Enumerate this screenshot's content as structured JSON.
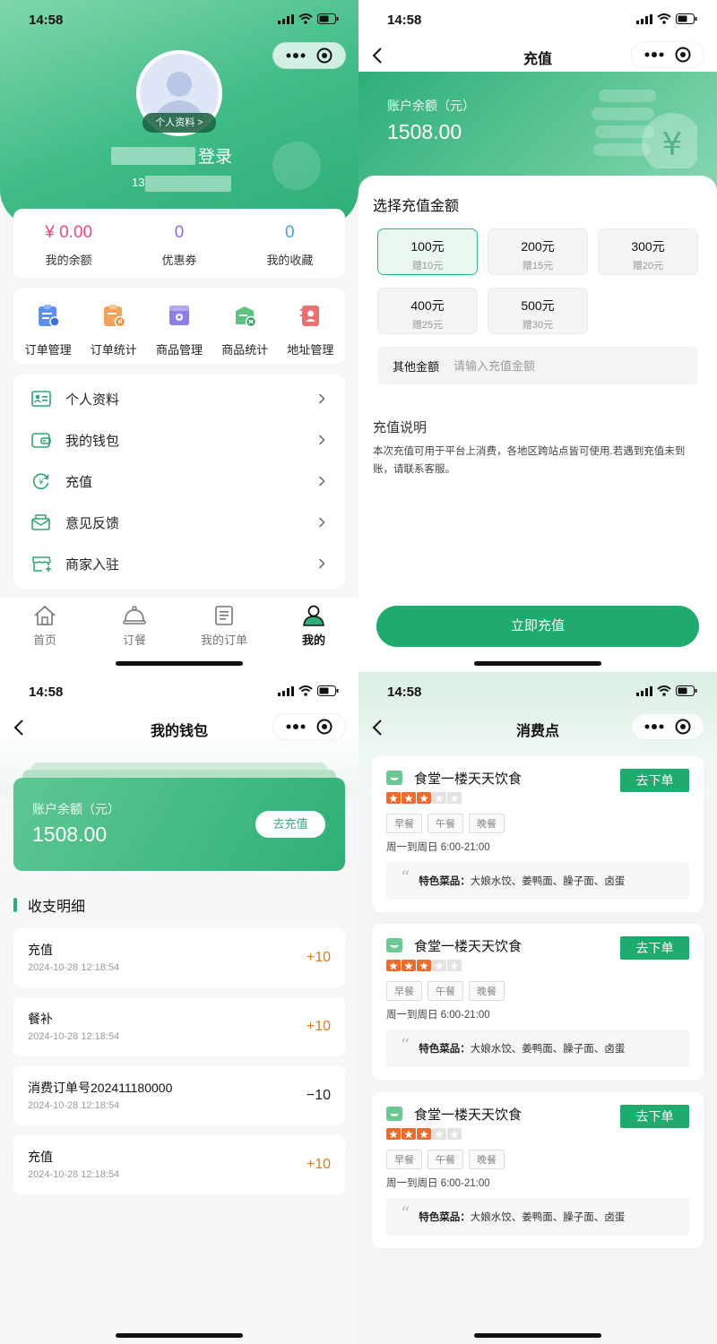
{
  "status_time": "14:58",
  "colors": {
    "primary": "#1faa6e",
    "header": "#3fbb86",
    "orange": "#e07c16",
    "balance_red": "#e6487a",
    "coupon_purple": "#8b6ce0",
    "fav_blue": "#4aa3e0"
  },
  "profile": {
    "avatar_tag": "个人资料 >",
    "login_label": "登录",
    "phone_prefix": "13",
    "stats": [
      {
        "value": "¥ 0.00",
        "label": "我的余额"
      },
      {
        "value": "0",
        "label": "优惠券"
      },
      {
        "value": "0",
        "label": "我的收藏"
      }
    ],
    "grid": [
      {
        "label": "订单管理",
        "icon": "order-manage-icon"
      },
      {
        "label": "订单统计",
        "icon": "order-stats-icon"
      },
      {
        "label": "商品管理",
        "icon": "product-manage-icon"
      },
      {
        "label": "商品统计",
        "icon": "product-stats-icon"
      },
      {
        "label": "地址管理",
        "icon": "address-manage-icon"
      }
    ],
    "menu": [
      {
        "label": "个人资料",
        "icon": "profile-card-icon"
      },
      {
        "label": "我的钱包",
        "icon": "wallet-icon"
      },
      {
        "label": "充值",
        "icon": "recharge-icon"
      },
      {
        "label": "意见反馈",
        "icon": "feedback-icon"
      },
      {
        "label": "商家入驻",
        "icon": "merchant-icon"
      }
    ],
    "tabs": [
      {
        "label": "首页",
        "icon": "home-icon"
      },
      {
        "label": "订餐",
        "icon": "dining-cloche-icon"
      },
      {
        "label": "我的订单",
        "icon": "orders-doc-icon"
      },
      {
        "label": "我的",
        "icon": "user-icon",
        "active": true
      }
    ]
  },
  "recharge": {
    "title": "充值",
    "balance_label": "账户余额（元）",
    "balance": "1508.00",
    "choose_title": "选择充值金额",
    "amounts": [
      {
        "amount": "100元",
        "gift": "赠10元",
        "selected": true
      },
      {
        "amount": "200元",
        "gift": "赠15元"
      },
      {
        "amount": "300元",
        "gift": "赠20元"
      },
      {
        "amount": "400元",
        "gift": "赠25元"
      },
      {
        "amount": "500元",
        "gift": "赠30元"
      }
    ],
    "other_label": "其他金额",
    "other_placeholder": "请输入充值金额",
    "desc_title": "充值说明",
    "desc_text": "本次充值可用于平台上消费，各地区跨站点皆可使用.若遇到充值未到账，请联系客服。",
    "submit": "立即充值"
  },
  "wallet": {
    "title": "我的钱包",
    "balance_label": "账户余额（元）",
    "balance": "1508.00",
    "recharge_btn": "去充值",
    "ledger_title": "收支明细",
    "records": [
      {
        "title": "充值",
        "date": "2024-10-28 12:18:54",
        "amount": "+10",
        "positive": true
      },
      {
        "title": "餐补",
        "date": "2024-10-28 12:18:54",
        "amount": "+10",
        "positive": true
      },
      {
        "title": "消费订单号202411180000",
        "date": "2024-10-28 12:18:54",
        "amount": "−10",
        "positive": false
      },
      {
        "title": "充值",
        "date": "2024-10-28 12:18:54",
        "amount": "+10",
        "positive": true
      }
    ]
  },
  "points": {
    "title": "消费点",
    "shops": [
      {
        "name": "食堂一楼天天饮食",
        "rating": 3,
        "rating_max": 5,
        "tags": [
          "早餐",
          "午餐",
          "晚餐"
        ],
        "hours": "周一到周日 6:00-21:00",
        "special_label": "特色菜品：",
        "special": "大娘水饺、姜鸭面、臊子面、卤蛋",
        "order_btn": "去下单"
      },
      {
        "name": "食堂一楼天天饮食",
        "rating": 3,
        "rating_max": 5,
        "tags": [
          "早餐",
          "午餐",
          "晚餐"
        ],
        "hours": "周一到周日 6:00-21:00",
        "special_label": "特色菜品：",
        "special": "大娘水饺、姜鸭面、臊子面、卤蛋",
        "order_btn": "去下单"
      },
      {
        "name": "食堂一楼天天饮食",
        "rating": 3,
        "rating_max": 5,
        "tags": [
          "早餐",
          "午餐",
          "晚餐"
        ],
        "hours": "周一到周日 6:00-21:00",
        "special_label": "特色菜品：",
        "special": "大娘水饺、姜鸭面、臊子面、卤蛋",
        "order_btn": "去下单"
      }
    ]
  }
}
